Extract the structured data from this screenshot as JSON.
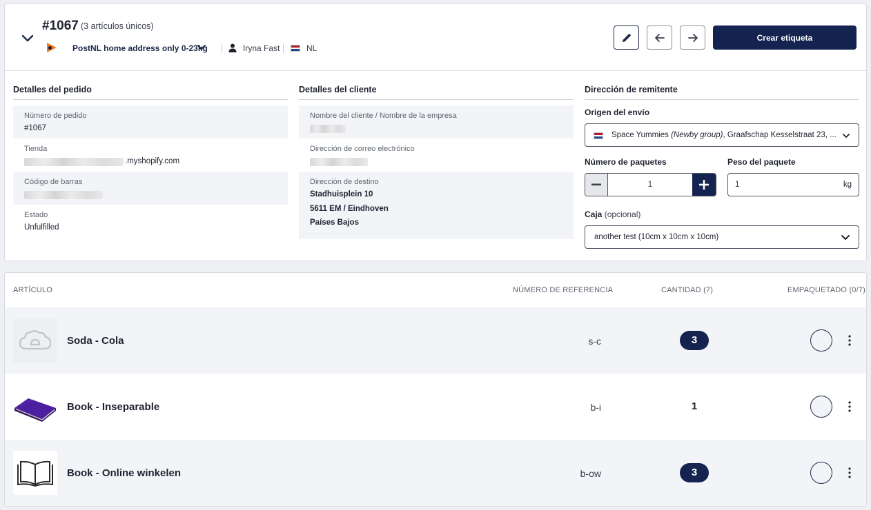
{
  "header": {
    "order_number": "#1067",
    "order_subtitle": "(3 artículos únicos)",
    "carrier": "PostNL home address only 0-23kg",
    "user": "Iryna Fast",
    "country": "NL",
    "create_label_button": "Crear etiqueta"
  },
  "order_details": {
    "title": "Detalles del pedido",
    "order_number_label": "Número de pedido",
    "order_number_value": "#1067",
    "store_label": "Tienda",
    "store_suffix": ".myshopify.com",
    "barcode_label": "Código de barras",
    "status_label": "Estado",
    "status_value": "Unfulfilled"
  },
  "customer_details": {
    "title": "Detalles del cliente",
    "name_label": "Nombre del cliente / Nombre de la empresa",
    "email_label": "Dirección de correo electrónico",
    "destination_label": "Dirección de destino",
    "address_line1": "Stadhuisplein 10",
    "address_line2": "5611 EM / Eindhoven",
    "address_line3": "Países Bajos"
  },
  "sender": {
    "title": "Dirección de remitente",
    "origin_label": "Origen del envío",
    "origin_name": "Space Yummies",
    "origin_group": "(Newby group)",
    "origin_address": ", Graafschap Kesselstraat 23, ...",
    "packages_label": "Número de paquetes",
    "packages_value": "1",
    "weight_label": "Peso del paquete",
    "weight_value": "1",
    "weight_unit": "kg",
    "box_label": "Caja",
    "box_optional": "(opcional)",
    "box_value": "another test (10cm x 10cm x 10cm)"
  },
  "items_table": {
    "headers": {
      "article": "ARTÍCULO",
      "reference": "NÚMERO DE REFERENCIA",
      "quantity": "CANTIDAD (7)",
      "packed": "EMPAQUETADO (0/7)"
    },
    "rows": [
      {
        "name": "Soda - Cola",
        "ref": "s-c",
        "qty": "3"
      },
      {
        "name": "Book - Inseparable",
        "ref": "b-i",
        "qty": "1"
      },
      {
        "name": "Book - Online winkelen",
        "ref": "b-ow",
        "qty": "3"
      }
    ]
  },
  "icons": {
    "collapse": "chevron-down-icon",
    "carrier": "postnl-logo-icon",
    "user": "user-icon",
    "flag": "netherlands-flag-icon",
    "edit": "pencil-icon",
    "prev": "arrow-left-icon",
    "next": "arrow-right-icon",
    "more": "kebab-menu-icon"
  },
  "colors": {
    "primary": "#142350",
    "carrier_orange": "#f37a1f",
    "row_shade": "#f3f4f7"
  }
}
